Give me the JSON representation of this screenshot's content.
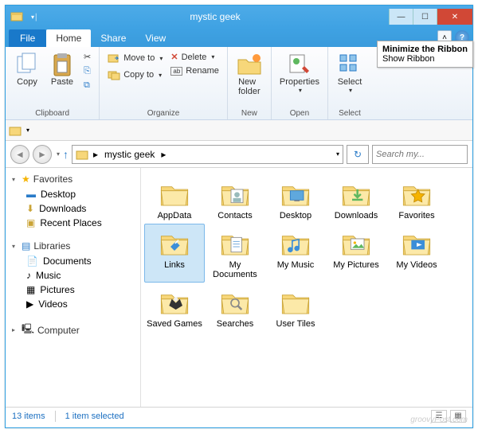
{
  "titlebar": {
    "title": "mystic geek"
  },
  "tabs": {
    "file": "File",
    "home": "Home",
    "share": "Share",
    "view": "View"
  },
  "tooltip": {
    "title": "Minimize the Ribbon",
    "body": "Show Ribbon"
  },
  "ribbon": {
    "clipboard": {
      "label": "Clipboard",
      "copy": "Copy",
      "paste": "Paste"
    },
    "organize": {
      "label": "Organize",
      "moveTo": "Move to",
      "copyTo": "Copy to",
      "delete": "Delete",
      "rename": "Rename"
    },
    "new": {
      "label": "New",
      "newFolder": "New\nfolder"
    },
    "open": {
      "label": "Open",
      "properties": "Properties"
    },
    "select": {
      "label": "Select",
      "select": "Select"
    }
  },
  "address": {
    "root": "mystic geek",
    "sep": "▸"
  },
  "search": {
    "placeholder": "Search my..."
  },
  "sidebar": {
    "favorites": "Favorites",
    "favItems": [
      "Desktop",
      "Downloads",
      "Recent Places"
    ],
    "libraries": "Libraries",
    "libItems": [
      "Documents",
      "Music",
      "Pictures",
      "Videos"
    ],
    "computer": "Computer"
  },
  "folders": [
    {
      "name": "AppData",
      "kind": "folder"
    },
    {
      "name": "Contacts",
      "kind": "contacts"
    },
    {
      "name": "Desktop",
      "kind": "desktop"
    },
    {
      "name": "Downloads",
      "kind": "downloads"
    },
    {
      "name": "Favorites",
      "kind": "favorites"
    },
    {
      "name": "Links",
      "kind": "links",
      "selected": true
    },
    {
      "name": "My Documents",
      "kind": "docs"
    },
    {
      "name": "My Music",
      "kind": "music"
    },
    {
      "name": "My Pictures",
      "kind": "pictures"
    },
    {
      "name": "My Videos",
      "kind": "videos"
    },
    {
      "name": "Saved Games",
      "kind": "games"
    },
    {
      "name": "Searches",
      "kind": "search"
    },
    {
      "name": "User Tiles",
      "kind": "folder"
    }
  ],
  "status": {
    "count": "13 items",
    "selection": "1 item selected"
  },
  "watermark": "groovyPost.com"
}
